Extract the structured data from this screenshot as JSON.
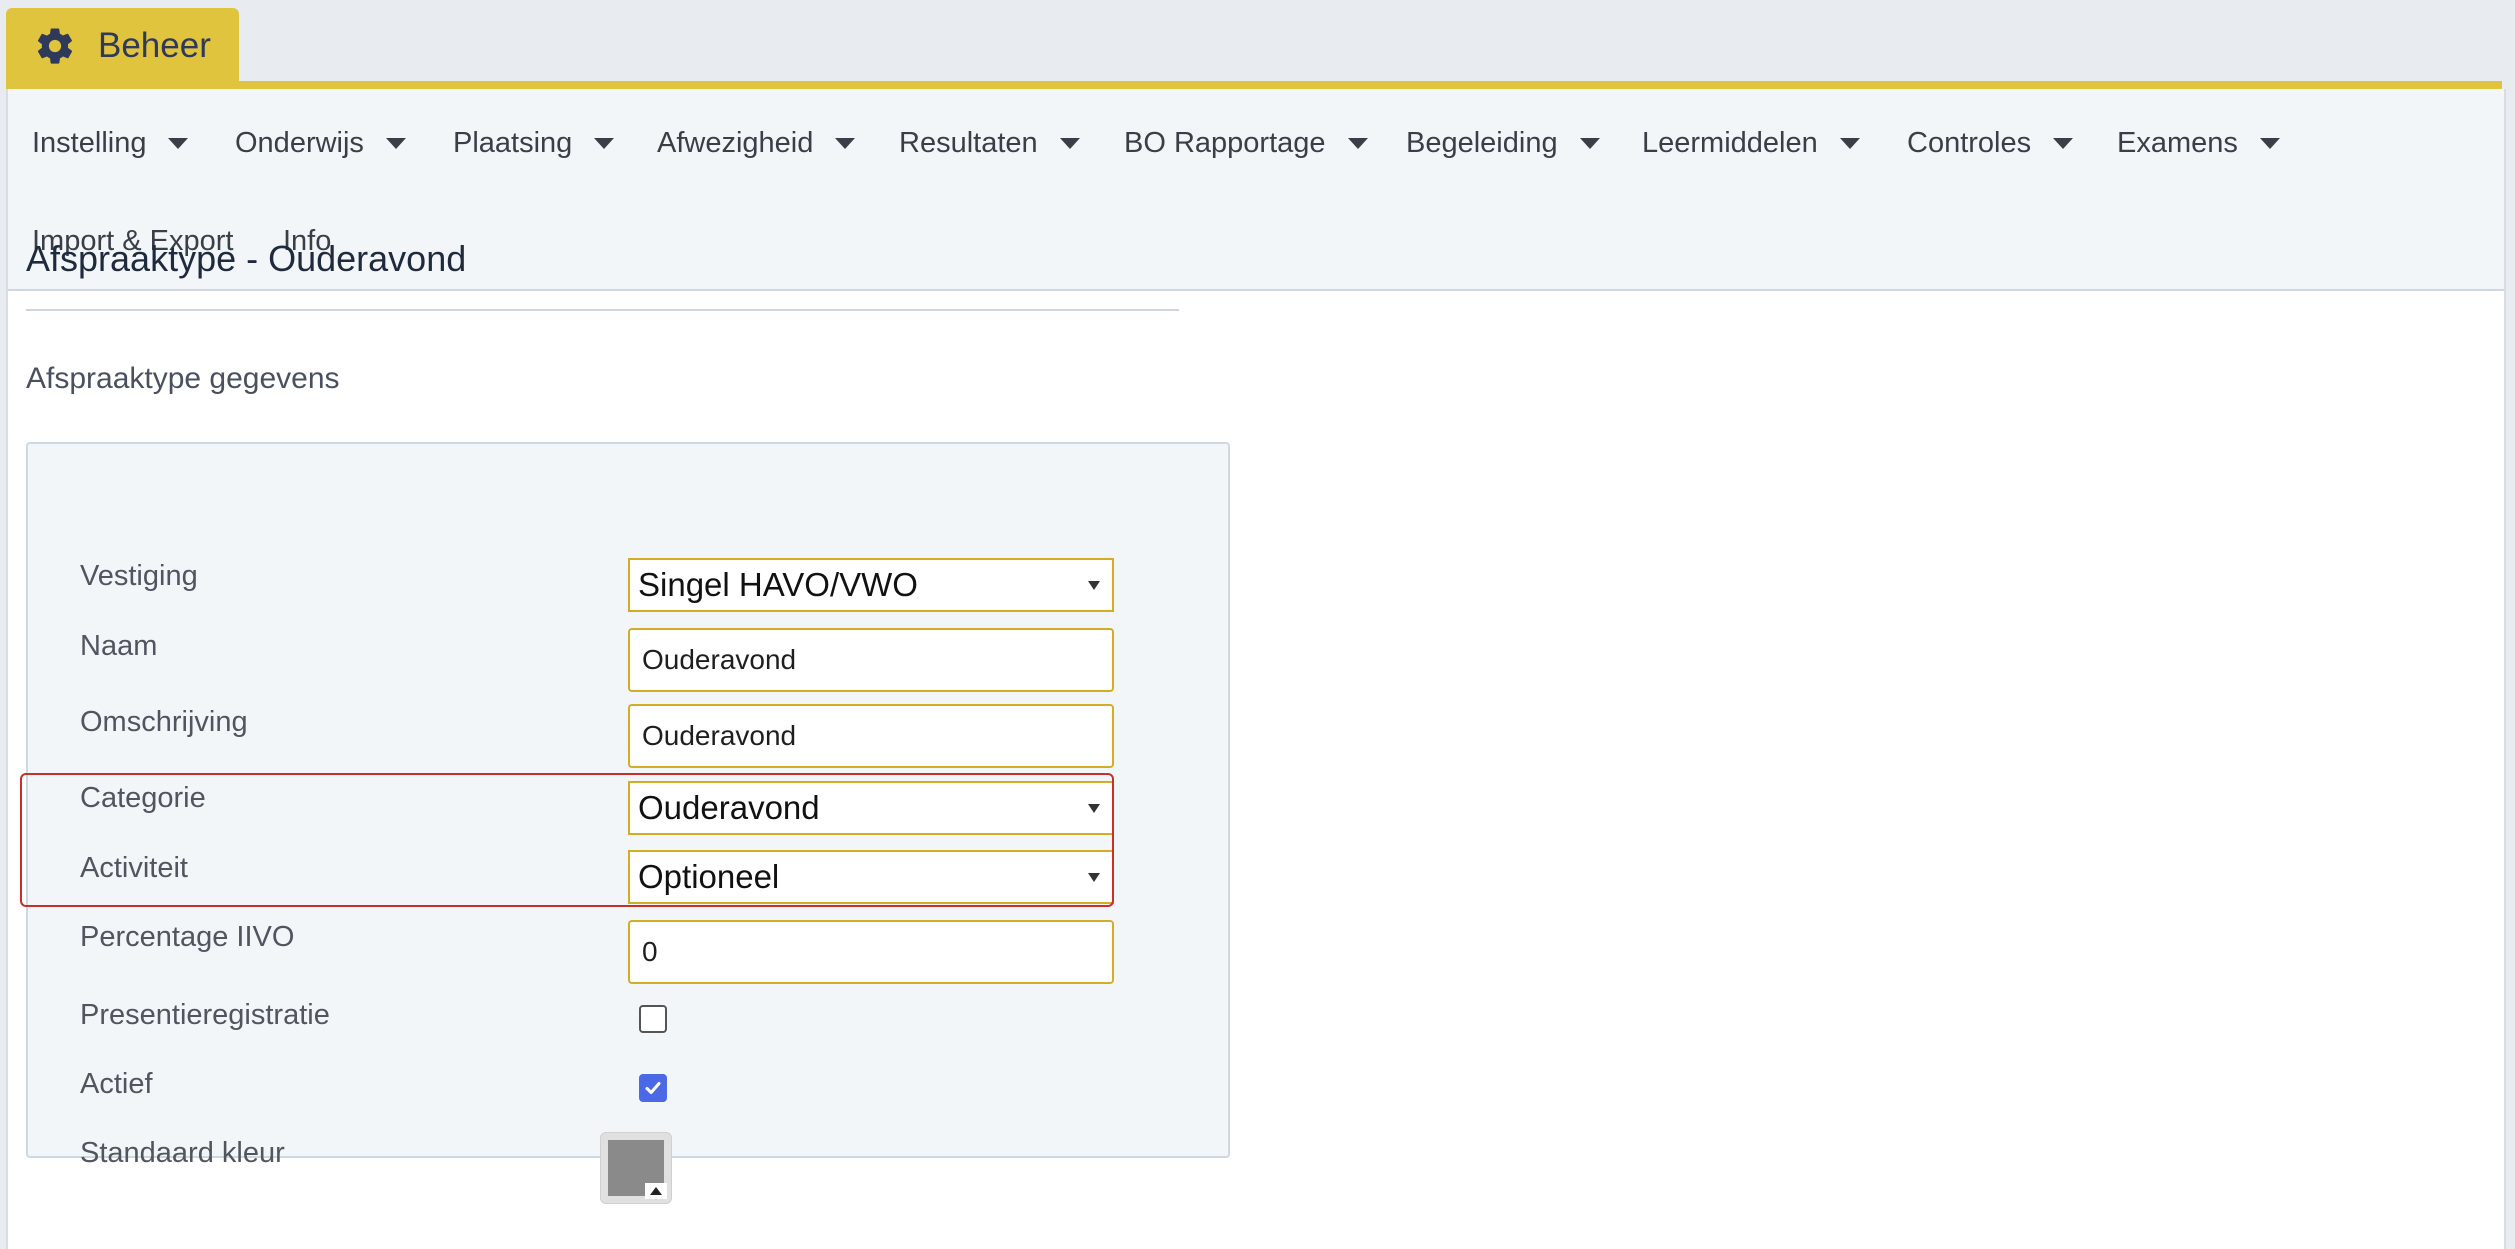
{
  "tab": {
    "title": "Beheer",
    "icon": "gear-icon"
  },
  "menu": {
    "row1": [
      {
        "label": "Instelling",
        "key": "I"
      },
      {
        "label": "Onderwijs",
        "key": "w"
      },
      {
        "label": "Plaatsing",
        "key": "P"
      },
      {
        "label": "Afwezigheid",
        "key": "f"
      },
      {
        "label": "Resultaten",
        "key": "R"
      },
      {
        "label": "BO Rapportage",
        "key": "a"
      },
      {
        "label": "Begeleiding",
        "key": "l"
      },
      {
        "label": "Leermiddelen",
        "key": "e"
      },
      {
        "label": "Controles",
        "key": "C"
      },
      {
        "label": "Examens",
        "key": "x"
      }
    ],
    "row2": [
      {
        "label": "Import & Export",
        "key": "m"
      },
      {
        "label": "Info",
        "key": "I"
      }
    ]
  },
  "page": {
    "title": "Afspraaktype - Ouderavond",
    "section_title": "Afspraaktype gegevens"
  },
  "form": {
    "vestiging": {
      "label": "Vestiging",
      "value": "Singel HAVO/VWO"
    },
    "naam": {
      "label": "Naam",
      "value": "Ouderavond"
    },
    "omschrijving": {
      "label": "Omschrijving",
      "value": "Ouderavond"
    },
    "categorie": {
      "label": "Categorie",
      "value": "Ouderavond"
    },
    "activiteit": {
      "label": "Activiteit",
      "value": "Optioneel"
    },
    "percentage": {
      "label": "Percentage IIVO",
      "value": "0"
    },
    "presentie": {
      "label": "Presentieregistratie",
      "checked": false
    },
    "actief": {
      "label": "Actief",
      "checked": true
    },
    "kleur": {
      "label": "Standaard kleur",
      "value": "#8a8a8a"
    }
  },
  "colors": {
    "accent": "#e1c43d",
    "input_border": "#d3ad25",
    "highlight": "#c9302c",
    "checkbox_checked": "#4b69e6"
  }
}
